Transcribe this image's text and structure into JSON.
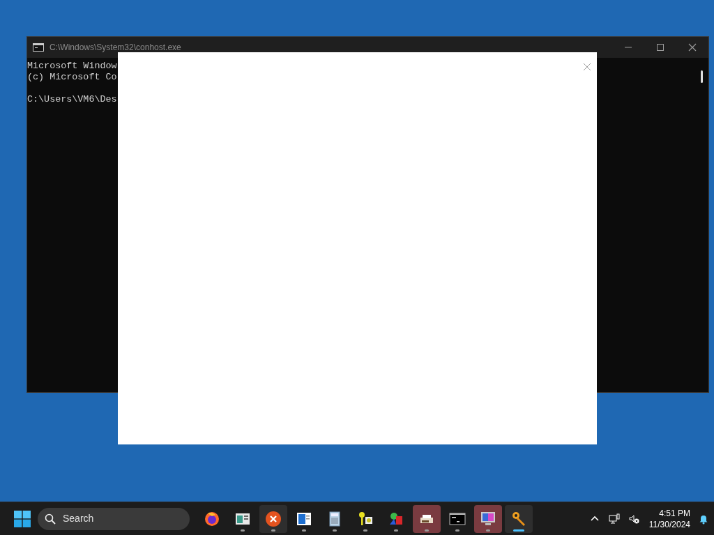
{
  "console_window": {
    "title": "C:\\Windows\\System32\\conhost.exe",
    "paragraphs": [
      [
        "Microsoft Window",
        "(c) Microsoft Co"
      ],
      [
        "C:\\Users\\VM6\\Des"
      ]
    ]
  },
  "dialog": {
    "kind": "blank"
  },
  "taskbar": {
    "search": {
      "placeholder": "Search"
    },
    "apps": [
      {
        "kind": "firefox",
        "selected": false,
        "attention": false
      },
      {
        "kind": "viewer",
        "running": true,
        "selected": false,
        "attention": false
      },
      {
        "kind": "error",
        "running": true,
        "selected": true,
        "attention": false
      },
      {
        "kind": "document",
        "running": true,
        "selected": false,
        "attention": false
      },
      {
        "kind": "calculator",
        "running": true,
        "selected": false,
        "attention": false
      },
      {
        "kind": "keys",
        "running": true,
        "selected": false,
        "attention": false
      },
      {
        "kind": "shapes",
        "running": true,
        "selected": false,
        "attention": false
      },
      {
        "kind": "printer",
        "running": true,
        "selected": false,
        "attention": true
      },
      {
        "kind": "terminal",
        "running": true,
        "selected": false,
        "attention": false
      },
      {
        "kind": "monitor",
        "running": true,
        "selected": false,
        "attention": true
      },
      {
        "kind": "key",
        "running": true,
        "selected": true,
        "attention": false,
        "active": true
      }
    ],
    "clock": {
      "time": "4:51 PM",
      "date": "11/30/2024"
    }
  }
}
